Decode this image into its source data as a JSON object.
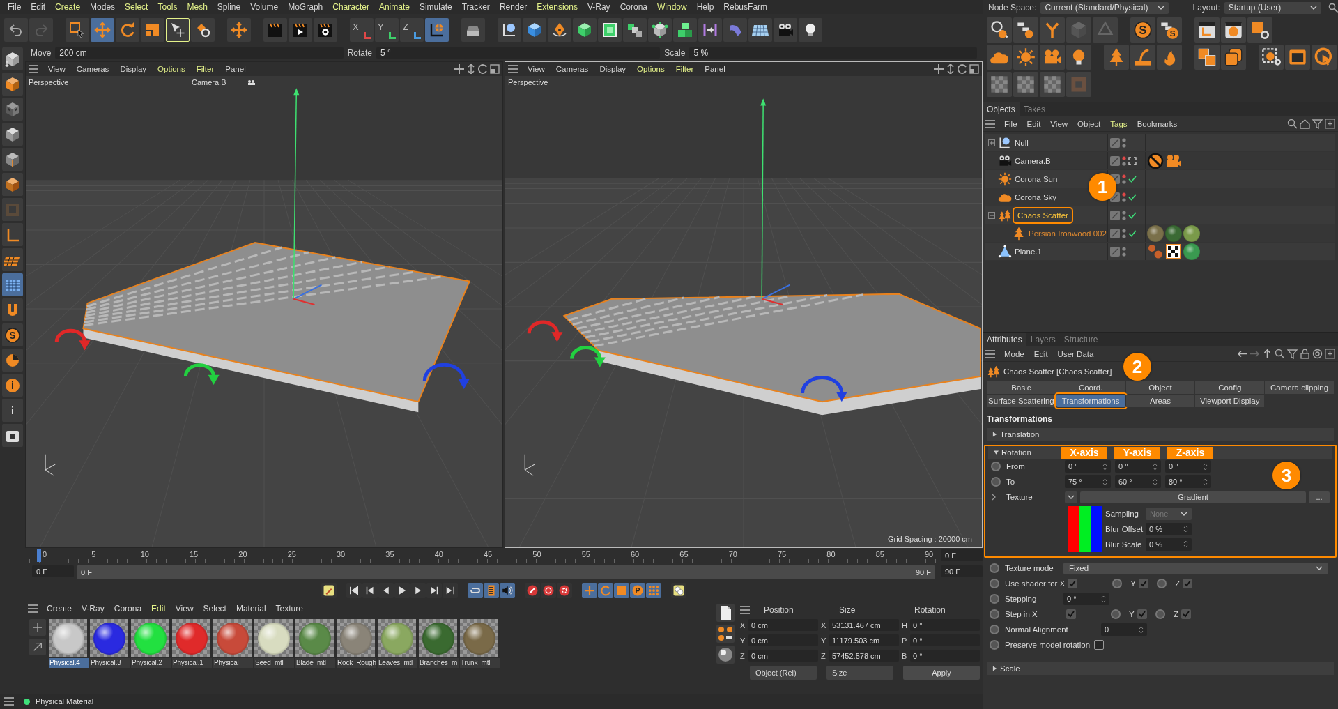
{
  "menu_bar": [
    {
      "label": "File",
      "highlighted": false
    },
    {
      "label": "Edit",
      "highlighted": false
    },
    {
      "label": "Create",
      "highlighted": true
    },
    {
      "label": "Modes",
      "highlighted": false
    },
    {
      "label": "Select",
      "highlighted": true
    },
    {
      "label": "Tools",
      "highlighted": true
    },
    {
      "label": "Mesh",
      "highlighted": true
    },
    {
      "label": "Spline",
      "highlighted": false
    },
    {
      "label": "Volume",
      "highlighted": false
    },
    {
      "label": "MoGraph",
      "highlighted": false
    },
    {
      "label": "Character",
      "highlighted": true
    },
    {
      "label": "Animate",
      "highlighted": true
    },
    {
      "label": "Simulate",
      "highlighted": false
    },
    {
      "label": "Tracker",
      "highlighted": false
    },
    {
      "label": "Render",
      "highlighted": false
    },
    {
      "label": "Extensions",
      "highlighted": true
    },
    {
      "label": "V-Ray",
      "highlighted": false
    },
    {
      "label": "Corona",
      "highlighted": false
    },
    {
      "label": "Window",
      "highlighted": true
    },
    {
      "label": "Help",
      "highlighted": false
    },
    {
      "label": "RebusFarm",
      "highlighted": false
    }
  ],
  "node_space": {
    "label": "Node Space:",
    "value": "Current (Standard/Physical)"
  },
  "layout": {
    "label": "Layout:",
    "value": "Startup (User)"
  },
  "main_toolbar": [
    {
      "kind": "undo",
      "selected": false
    },
    {
      "kind": "redo",
      "selected": false
    },
    {
      "kind": "gap"
    },
    {
      "kind": "select",
      "selected": false
    },
    {
      "kind": "move",
      "selected": true
    },
    {
      "kind": "rotate",
      "selected": false
    },
    {
      "kind": "scale",
      "selected": false
    },
    {
      "kind": "transform",
      "selected": false,
      "outlined": true
    },
    {
      "kind": "recent",
      "selected": false
    },
    {
      "kind": "gap"
    },
    {
      "kind": "move",
      "selected": false
    },
    {
      "kind": "gap"
    },
    {
      "kind": "clapper",
      "selected": false
    },
    {
      "kind": "clapper_play",
      "selected": false
    },
    {
      "kind": "clapper_gear",
      "selected": false
    },
    {
      "kind": "gap"
    },
    {
      "kind": "axis",
      "glyph": "X",
      "color": "#e04848",
      "selected": false
    },
    {
      "kind": "axis",
      "glyph": "Y",
      "color": "#3ecf6a",
      "selected": false
    },
    {
      "kind": "axis",
      "glyph": "Z",
      "color": "#4a9be0",
      "selected": false
    },
    {
      "kind": "world",
      "selected": true
    },
    {
      "kind": "gap"
    },
    {
      "kind": "tray",
      "selected": false
    },
    {
      "kind": "gap"
    },
    {
      "kind": "null",
      "selected": false
    },
    {
      "kind": "cube",
      "selected": false
    },
    {
      "kind": "pen",
      "selected": false
    },
    {
      "kind": "gcube",
      "selected": false
    },
    {
      "kind": "subdiv",
      "selected": false
    },
    {
      "kind": "cloner",
      "selected": false
    },
    {
      "kind": "atom",
      "selected": false
    },
    {
      "kind": "array",
      "selected": false
    },
    {
      "kind": "deformer",
      "selected": false
    },
    {
      "kind": "bend",
      "selected": false
    },
    {
      "kind": "floorgrid",
      "selected": false
    },
    {
      "kind": "camera",
      "selected": false
    },
    {
      "kind": "bulb",
      "selected": false
    }
  ],
  "right_toolbar": [
    [
      {
        "kind": "searchball"
      },
      {
        "kind": "hierball"
      },
      {
        "kind": "fork"
      },
      {
        "kind": "cubedis"
      },
      {
        "kind": "tridis"
      },
      {
        "kind": "gap"
      },
      {
        "kind": "sglyph",
        "glyph": "S"
      },
      {
        "kind": "shier",
        "glyph": "S"
      },
      {
        "kind": "gap"
      },
      {
        "kind": "frame"
      },
      {
        "kind": "framesphere"
      },
      {
        "kind": "sqgear"
      }
    ],
    [
      {
        "kind": "cloud"
      },
      {
        "kind": "sun"
      },
      {
        "kind": "camo"
      },
      {
        "kind": "obulb"
      },
      {
        "kind": "gap"
      },
      {
        "kind": "tree"
      },
      {
        "kind": "hair"
      },
      {
        "kind": "fire"
      },
      {
        "kind": "gap"
      },
      {
        "kind": "layers"
      },
      {
        "kind": "stack"
      },
      {
        "kind": "gap"
      },
      {
        "kind": "targetgear"
      },
      {
        "kind": "window"
      },
      {
        "kind": "cursor"
      }
    ],
    [
      {
        "kind": "checker"
      },
      {
        "kind": "checker"
      },
      {
        "kind": "checker"
      },
      {
        "kind": "tilebox"
      }
    ]
  ],
  "left_toolbar": [
    {
      "kind": "modelmode",
      "selected": false
    },
    {
      "kind": "lcube",
      "selected": false
    },
    {
      "kind": "checkercube",
      "selected": false
    },
    {
      "kind": "polycube",
      "selected": false
    },
    {
      "kind": "edgecube",
      "selected": false
    },
    {
      "kind": "ptcube",
      "selected": false
    },
    {
      "kind": "texsquare",
      "selected": false
    },
    {
      "kind": "laxis",
      "selected": false
    },
    {
      "kind": "ogrid",
      "selected": false
    },
    {
      "kind": "bgrid",
      "selected": true
    },
    {
      "kind": "magnet",
      "selected": false
    },
    {
      "kind": "sglyph",
      "glyph": "S",
      "selected": false
    },
    {
      "kind": "dial",
      "selected": false
    },
    {
      "kind": "oinfo",
      "glyph": "i",
      "selected": false
    },
    {
      "kind": "info",
      "glyph": "i",
      "selected": false
    },
    {
      "kind": "boxbag",
      "selected": false
    }
  ],
  "tool_options": [
    {
      "label": "Move",
      "value": "200 cm"
    },
    {
      "label": "Rotate",
      "value": "5 °"
    },
    {
      "label": "Scale",
      "value": "5 %"
    }
  ],
  "viewports": [
    {
      "selected": false,
      "title": "Perspective",
      "camera": "Camera.B",
      "menu": [
        {
          "label": "View",
          "highlighted": false
        },
        {
          "label": "Cameras",
          "highlighted": false
        },
        {
          "label": "Display",
          "highlighted": false
        },
        {
          "label": "Options",
          "highlighted": true
        },
        {
          "label": "Filter",
          "highlighted": true
        },
        {
          "label": "Panel",
          "highlighted": false
        }
      ]
    },
    {
      "selected": true,
      "title": "Perspective",
      "grid_spacing": "Grid Spacing : 20000 cm",
      "menu": [
        {
          "label": "View",
          "highlighted": false
        },
        {
          "label": "Cameras",
          "highlighted": false
        },
        {
          "label": "Display",
          "highlighted": false
        },
        {
          "label": "Options",
          "highlighted": true
        },
        {
          "label": "Filter",
          "highlighted": true
        },
        {
          "label": "Panel",
          "highlighted": false
        }
      ]
    }
  ],
  "timeline": {
    "ticks": [
      "0",
      "5",
      "10",
      "15",
      "20",
      "25",
      "30",
      "35",
      "40",
      "45",
      "50",
      "55",
      "60",
      "65",
      "70",
      "75",
      "80",
      "85",
      "90"
    ],
    "playhead": {
      "level": 0
    },
    "current_frame": "0 F",
    "start_field": "0 F",
    "range_start": "0 F",
    "range_end": "90 F",
    "end_field": "90 F"
  },
  "transport": [
    {
      "kind": "brushkey"
    },
    {
      "kind": "gap"
    },
    {
      "kind": "tofirst"
    },
    {
      "kind": "prevkey"
    },
    {
      "kind": "prevframe"
    },
    {
      "kind": "play"
    },
    {
      "kind": "nextframe"
    },
    {
      "kind": "nextkey"
    },
    {
      "kind": "tolast"
    },
    {
      "kind": "gap"
    },
    {
      "kind": "loop",
      "selected": true
    },
    {
      "kind": "film",
      "selected": true
    },
    {
      "kind": "speaker",
      "selected": true
    },
    {
      "kind": "gap"
    },
    {
      "kind": "keyrec"
    },
    {
      "kind": "autokey"
    },
    {
      "kind": "keyset"
    },
    {
      "kind": "gap"
    },
    {
      "kind": "kmove",
      "selected": true
    },
    {
      "kind": "krot",
      "selected": true
    },
    {
      "kind": "kscale",
      "selected": true
    },
    {
      "kind": "kparam",
      "glyph": "P",
      "selected": true
    },
    {
      "kind": "kdots",
      "selected": true
    },
    {
      "kind": "gap"
    },
    {
      "kind": "keyyellow"
    }
  ],
  "materials": {
    "menu": [
      {
        "label": "Create",
        "highlighted": false
      },
      {
        "label": "V-Ray",
        "highlighted": false
      },
      {
        "label": "Corona",
        "highlighted": false
      },
      {
        "label": "Edit",
        "highlighted": true
      },
      {
        "label": "View",
        "highlighted": false
      },
      {
        "label": "Select",
        "highlighted": false
      },
      {
        "label": "Material",
        "highlighted": false
      },
      {
        "label": "Texture",
        "highlighted": false
      }
    ],
    "items": [
      {
        "name": "Physical.4",
        "color": "#c8c8c8",
        "selected": true
      },
      {
        "name": "Physical.3",
        "color": "#2a2ae0",
        "selected": false
      },
      {
        "name": "Physical.2",
        "color": "#22e040",
        "selected": false
      },
      {
        "name": "Physical.1",
        "color": "#e02a2a",
        "selected": false
      },
      {
        "name": "Physical",
        "color": "#c84a3a",
        "selected": false
      },
      {
        "name": "Seed_mtl",
        "color": "#d8dcc0",
        "selected": false
      },
      {
        "name": "Blade_mtl",
        "color": "#5a8a48",
        "selected": false
      },
      {
        "name": "Rock_Rough",
        "color": "#8a8478",
        "selected": false
      },
      {
        "name": "Leaves_mtl",
        "color": "#8aa860",
        "selected": false
      },
      {
        "name": "Branches_m",
        "color": "#3a6a30",
        "selected": false
      },
      {
        "name": "Trunk_mtl",
        "color": "#7a6a48",
        "selected": false
      }
    ]
  },
  "coordinates": {
    "headers": [
      "Position",
      "Size",
      "Rotation"
    ],
    "rows": [
      {
        "axis": "X",
        "position": "0 cm",
        "size_axis": "X",
        "size": "53131.467 cm",
        "rot_axis": "H",
        "rotation": "0 °"
      },
      {
        "axis": "Y",
        "position": "0 cm",
        "size_axis": "Y",
        "size": "11179.503 cm",
        "rot_axis": "P",
        "rotation": "0 °"
      },
      {
        "axis": "Z",
        "position": "0 cm",
        "size_axis": "Z",
        "size": "57452.578 cm",
        "rot_axis": "B",
        "rotation": "0 °"
      }
    ],
    "mode": "Object (Rel)",
    "size_mode": "Size",
    "apply": "Apply"
  },
  "status_bar": {
    "text": "Physical Material"
  },
  "objects_panel": {
    "tabs": [
      {
        "label": "Objects",
        "selected": true
      },
      {
        "label": "Takes",
        "selected": false
      }
    ],
    "menu": [
      {
        "label": "File",
        "highlighted": false
      },
      {
        "label": "Edit",
        "highlighted": false
      },
      {
        "label": "View",
        "highlighted": false
      },
      {
        "label": "Object",
        "highlighted": false
      },
      {
        "label": "Tags",
        "highlighted": true
      },
      {
        "label": "Bookmarks",
        "highlighted": false
      }
    ],
    "tree": [
      {
        "name": "Null",
        "kind": "null",
        "expanded": false,
        "selected": false,
        "editor_off": false,
        "enabled": false,
        "framed": false
      },
      {
        "name": "Camera.B",
        "kind": "camera",
        "selected": false,
        "editor_off": true,
        "enabled": false,
        "framed": true,
        "tags": [
          {
            "kind": "protection"
          },
          {
            "kind": "camera"
          }
        ]
      },
      {
        "name": "Corona Sun",
        "kind": "sun",
        "selected": false,
        "editor_off": true,
        "enabled": true,
        "framed": false
      },
      {
        "name": "Corona Sky",
        "kind": "cloud",
        "selected": false,
        "editor_off": true,
        "enabled": true,
        "framed": false
      },
      {
        "name": "Chaos Scatter",
        "kind": "trees",
        "expanded": true,
        "selected": true,
        "annotation": "1",
        "editor_off": false,
        "enabled": true,
        "framed": false,
        "children": [
          {
            "name": "Persian Ironwood 002",
            "kind": "tree",
            "selected": false,
            "asset": true,
            "editor_off": false,
            "enabled": true,
            "framed": false,
            "tags": [
              {
                "kind": "material",
                "color": "#7a704a"
              },
              {
                "kind": "material",
                "color": "#3a6a34"
              },
              {
                "kind": "material",
                "color": "#7a9a4a"
              }
            ]
          }
        ]
      },
      {
        "name": "Plane.1",
        "kind": "plane",
        "selected": false,
        "editor_off": false,
        "enabled": false,
        "framed": false,
        "tags": [
          {
            "kind": "phong"
          },
          {
            "kind": "checker"
          },
          {
            "kind": "material",
            "color": "#3a9a50"
          }
        ]
      }
    ]
  },
  "attributes_panel": {
    "tabs": [
      {
        "label": "Attributes",
        "selected": true
      },
      {
        "label": "Layers",
        "selected": false
      },
      {
        "label": "Structure",
        "selected": false
      }
    ],
    "menu": [
      {
        "label": "Mode",
        "highlighted": false
      },
      {
        "label": "Edit",
        "highlighted": false
      },
      {
        "label": "User Data",
        "highlighted": false
      }
    ],
    "object_title": "Chaos Scatter [Chaos Scatter]",
    "property_tabs": [
      [
        {
          "label": "Basic",
          "selected": false
        },
        {
          "label": "Coord.",
          "selected": false
        },
        {
          "label": "Object",
          "selected": false
        },
        {
          "label": "Config",
          "selected": false
        },
        {
          "label": "Camera clipping",
          "selected": false
        }
      ],
      [
        {
          "label": "Surface Scattering",
          "selected": false
        },
        {
          "label": "Transformations",
          "selected": true,
          "annotation": "2"
        },
        {
          "label": "Areas",
          "selected": false
        },
        {
          "label": "Viewport Display",
          "selected": false
        }
      ]
    ],
    "section_title": "Transformations",
    "groups": [
      {
        "title": "Translation",
        "expanded": false
      },
      {
        "title": "Rotation",
        "expanded": true,
        "annotation": "3",
        "axis_labels": [
          "X-axis",
          "Y-axis",
          "Z-axis"
        ],
        "rows": [
          {
            "kind": "vector",
            "label": "From",
            "values": [
              "0 °",
              "0 °",
              "0 °"
            ]
          },
          {
            "kind": "vector",
            "label": "To",
            "values": [
              "75 °",
              "60 °",
              "80 °"
            ]
          },
          {
            "kind": "texture",
            "label": "Texture",
            "value": "Gradient",
            "button": "...",
            "sub": [
              {
                "kind": "dropdown",
                "label": "Sampling",
                "value": "None",
                "disabled": true
              },
              {
                "kind": "number",
                "label": "Blur Offset",
                "value": "0 %"
              },
              {
                "kind": "number",
                "label": "Blur Scale",
                "value": "0 %"
              }
            ]
          }
        ],
        "extra_rows": [
          {
            "kind": "dropdown",
            "label": "Texture mode",
            "value": "Fixed",
            "disabled": false
          },
          {
            "kind": "checks",
            "label": "Use shader for X",
            "checked": true,
            "more": [
              {
                "label": "Y",
                "checked": true
              },
              {
                "label": "Z",
                "checked": true
              }
            ]
          },
          {
            "kind": "number",
            "label": "Stepping",
            "value": "0 °"
          },
          {
            "kind": "checks",
            "label": "Step in X",
            "checked": true,
            "more": [
              {
                "label": "Y",
                "checked": true
              },
              {
                "label": "Z",
                "checked": true
              }
            ]
          },
          {
            "kind": "number",
            "label": "Normal Alignment",
            "value": "0",
            "wide_label": true
          },
          {
            "kind": "checks",
            "label": "Preserve model rotation",
            "checked": false,
            "more": []
          }
        ]
      },
      {
        "title": "Scale",
        "expanded": false
      }
    ]
  }
}
